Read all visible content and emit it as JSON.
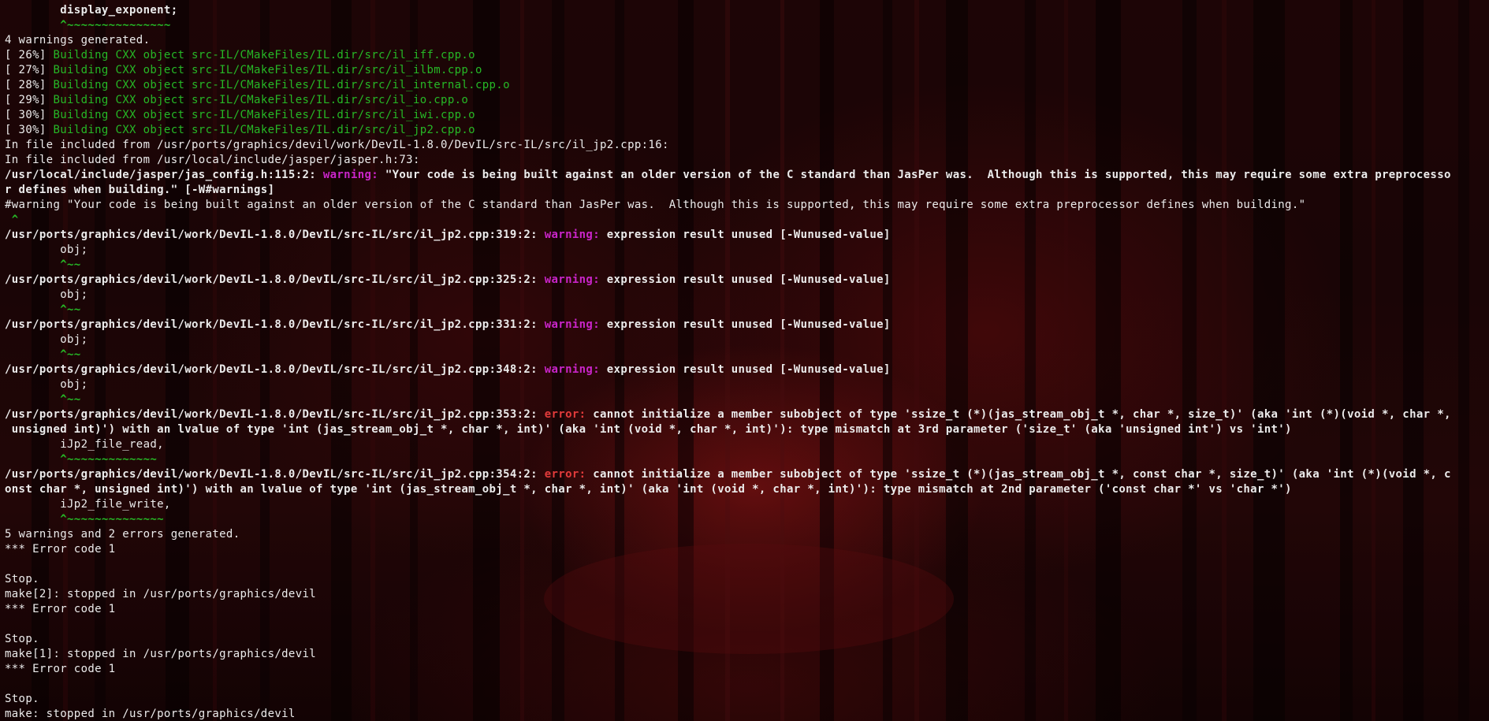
{
  "terminal": {
    "theme": {
      "background": "#1a0506",
      "foreground": "#ececec",
      "green": "#26b826",
      "magenta": "#c925c9",
      "red": "#e23b3b"
    },
    "lines": [
      [
        {
          "t": "        display_exponent;",
          "c": "normal",
          "b": true
        }
      ],
      [
        {
          "t": "        ^~~~~~~~~~~~~~~~",
          "c": "green",
          "b": true
        }
      ],
      [
        {
          "t": "4 warnings generated.",
          "c": "normal",
          "b": false
        }
      ],
      [
        {
          "t": "[ 26%] ",
          "c": "normal",
          "b": false
        },
        {
          "t": "Building CXX object src-IL/CMakeFiles/IL.dir/src/il_iff.cpp.o",
          "c": "green",
          "b": false
        }
      ],
      [
        {
          "t": "[ 27%] ",
          "c": "normal",
          "b": false
        },
        {
          "t": "Building CXX object src-IL/CMakeFiles/IL.dir/src/il_ilbm.cpp.o",
          "c": "green",
          "b": false
        }
      ],
      [
        {
          "t": "[ 28%] ",
          "c": "normal",
          "b": false
        },
        {
          "t": "Building CXX object src-IL/CMakeFiles/IL.dir/src/il_internal.cpp.o",
          "c": "green",
          "b": false
        }
      ],
      [
        {
          "t": "[ 29%] ",
          "c": "normal",
          "b": false
        },
        {
          "t": "Building CXX object src-IL/CMakeFiles/IL.dir/src/il_io.cpp.o",
          "c": "green",
          "b": false
        }
      ],
      [
        {
          "t": "[ 30%] ",
          "c": "normal",
          "b": false
        },
        {
          "t": "Building CXX object src-IL/CMakeFiles/IL.dir/src/il_iwi.cpp.o",
          "c": "green",
          "b": false
        }
      ],
      [
        {
          "t": "[ 30%] ",
          "c": "normal",
          "b": false
        },
        {
          "t": "Building CXX object src-IL/CMakeFiles/IL.dir/src/il_jp2.cpp.o",
          "c": "green",
          "b": false
        }
      ],
      [
        {
          "t": "In file included from /usr/ports/graphics/devil/work/DevIL-1.8.0/DevIL/src-IL/src/il_jp2.cpp:16:",
          "c": "normal",
          "b": false
        }
      ],
      [
        {
          "t": "In file included from /usr/local/include/jasper/jasper.h:73:",
          "c": "normal",
          "b": false
        }
      ],
      [
        {
          "t": "/usr/local/include/jasper/jas_config.h:115:2: ",
          "c": "normal",
          "b": true
        },
        {
          "t": "warning: ",
          "c": "magenta",
          "b": true
        },
        {
          "t": "\"Your code is being built against an older version of the C standard than JasPer was.  Although this is supported, this may require some extra preprocesso",
          "c": "normal",
          "b": true
        }
      ],
      [
        {
          "t": "r defines when building.\" [-W#warnings]",
          "c": "normal",
          "b": true
        }
      ],
      [
        {
          "t": "#warning \"Your code is being built against an older version of the C standard than JasPer was.  Although this is supported, this may require some extra preprocessor defines when building.\"",
          "c": "normal",
          "b": false
        }
      ],
      [
        {
          "t": " ^",
          "c": "green",
          "b": true
        }
      ],
      [
        {
          "t": "/usr/ports/graphics/devil/work/DevIL-1.8.0/DevIL/src-IL/src/il_jp2.cpp:319:2: ",
          "c": "normal",
          "b": true
        },
        {
          "t": "warning: ",
          "c": "magenta",
          "b": true
        },
        {
          "t": "expression result unused [-Wunused-value]",
          "c": "normal",
          "b": true
        }
      ],
      [
        {
          "t": "        obj;",
          "c": "normal",
          "b": false
        }
      ],
      [
        {
          "t": "        ^~~",
          "c": "green",
          "b": true
        }
      ],
      [
        {
          "t": "/usr/ports/graphics/devil/work/DevIL-1.8.0/DevIL/src-IL/src/il_jp2.cpp:325:2: ",
          "c": "normal",
          "b": true
        },
        {
          "t": "warning: ",
          "c": "magenta",
          "b": true
        },
        {
          "t": "expression result unused [-Wunused-value]",
          "c": "normal",
          "b": true
        }
      ],
      [
        {
          "t": "        obj;",
          "c": "normal",
          "b": false
        }
      ],
      [
        {
          "t": "        ^~~",
          "c": "green",
          "b": true
        }
      ],
      [
        {
          "t": "/usr/ports/graphics/devil/work/DevIL-1.8.0/DevIL/src-IL/src/il_jp2.cpp:331:2: ",
          "c": "normal",
          "b": true
        },
        {
          "t": "warning: ",
          "c": "magenta",
          "b": true
        },
        {
          "t": "expression result unused [-Wunused-value]",
          "c": "normal",
          "b": true
        }
      ],
      [
        {
          "t": "        obj;",
          "c": "normal",
          "b": false
        }
      ],
      [
        {
          "t": "        ^~~",
          "c": "green",
          "b": true
        }
      ],
      [
        {
          "t": "/usr/ports/graphics/devil/work/DevIL-1.8.0/DevIL/src-IL/src/il_jp2.cpp:348:2: ",
          "c": "normal",
          "b": true
        },
        {
          "t": "warning: ",
          "c": "magenta",
          "b": true
        },
        {
          "t": "expression result unused [-Wunused-value]",
          "c": "normal",
          "b": true
        }
      ],
      [
        {
          "t": "        obj;",
          "c": "normal",
          "b": false
        }
      ],
      [
        {
          "t": "        ^~~",
          "c": "green",
          "b": true
        }
      ],
      [
        {
          "t": "/usr/ports/graphics/devil/work/DevIL-1.8.0/DevIL/src-IL/src/il_jp2.cpp:353:2: ",
          "c": "normal",
          "b": true
        },
        {
          "t": "error: ",
          "c": "red",
          "b": true
        },
        {
          "t": "cannot initialize a member subobject of type 'ssize_t (*)(jas_stream_obj_t *, char *, size_t)' (aka 'int (*)(void *, char *,",
          "c": "normal",
          "b": true
        }
      ],
      [
        {
          "t": " unsigned int)') with an lvalue of type 'int (jas_stream_obj_t *, char *, int)' (aka 'int (void *, char *, int)'): type mismatch at 3rd parameter ('size_t' (aka 'unsigned int') vs 'int')",
          "c": "normal",
          "b": true
        }
      ],
      [
        {
          "t": "        iJp2_file_read,",
          "c": "normal",
          "b": false
        }
      ],
      [
        {
          "t": "        ^~~~~~~~~~~~~~",
          "c": "green",
          "b": true
        }
      ],
      [
        {
          "t": "/usr/ports/graphics/devil/work/DevIL-1.8.0/DevIL/src-IL/src/il_jp2.cpp:354:2: ",
          "c": "normal",
          "b": true
        },
        {
          "t": "error: ",
          "c": "red",
          "b": true
        },
        {
          "t": "cannot initialize a member subobject of type 'ssize_t (*)(jas_stream_obj_t *, const char *, size_t)' (aka 'int (*)(void *, c",
          "c": "normal",
          "b": true
        }
      ],
      [
        {
          "t": "onst char *, unsigned int)') with an lvalue of type 'int (jas_stream_obj_t *, char *, int)' (aka 'int (void *, char *, int)'): type mismatch at 2nd parameter ('const char *' vs 'char *')",
          "c": "normal",
          "b": true
        }
      ],
      [
        {
          "t": "        iJp2_file_write,",
          "c": "normal",
          "b": false
        }
      ],
      [
        {
          "t": "        ^~~~~~~~~~~~~~~",
          "c": "green",
          "b": true
        }
      ],
      [
        {
          "t": "5 warnings and 2 errors generated.",
          "c": "normal",
          "b": false
        }
      ],
      [
        {
          "t": "*** Error code 1",
          "c": "normal",
          "b": false
        }
      ],
      [
        {
          "t": "",
          "c": "normal",
          "b": false
        }
      ],
      [
        {
          "t": "Stop.",
          "c": "normal",
          "b": false
        }
      ],
      [
        {
          "t": "make[2]: stopped in /usr/ports/graphics/devil",
          "c": "normal",
          "b": false
        }
      ],
      [
        {
          "t": "*** Error code 1",
          "c": "normal",
          "b": false
        }
      ],
      [
        {
          "t": "",
          "c": "normal",
          "b": false
        }
      ],
      [
        {
          "t": "Stop.",
          "c": "normal",
          "b": false
        }
      ],
      [
        {
          "t": "make[1]: stopped in /usr/ports/graphics/devil",
          "c": "normal",
          "b": false
        }
      ],
      [
        {
          "t": "*** Error code 1",
          "c": "normal",
          "b": false
        }
      ],
      [
        {
          "t": "",
          "c": "normal",
          "b": false
        }
      ],
      [
        {
          "t": "Stop.",
          "c": "normal",
          "b": false
        }
      ],
      [
        {
          "t": "make: stopped in /usr/ports/graphics/devil",
          "c": "normal",
          "b": false
        }
      ]
    ]
  }
}
